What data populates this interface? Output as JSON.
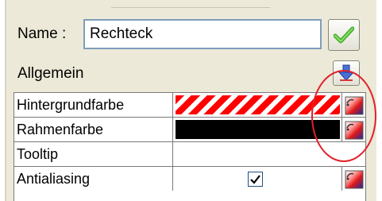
{
  "name_row": {
    "label": "Name :",
    "value": "Rechteck"
  },
  "section": {
    "label": "Allgemein"
  },
  "properties": [
    {
      "label": "Hintergrundfarbe",
      "value_type": "hatched-red"
    },
    {
      "label": "Rahmenfarbe",
      "value_type": "black"
    },
    {
      "label": "Tooltip",
      "value": ""
    },
    {
      "label": "Antialiasing",
      "checked": true
    }
  ],
  "icons": {
    "ok": "green-check-icon",
    "collapse": "blue-arrow-icon",
    "color_picker": "color-picker-icon"
  },
  "colors": {
    "accent_red": "#e0202a",
    "hatch_red": "#ff0000",
    "panel_bg": "#ece9d8",
    "input_border": "#7f9db9"
  }
}
